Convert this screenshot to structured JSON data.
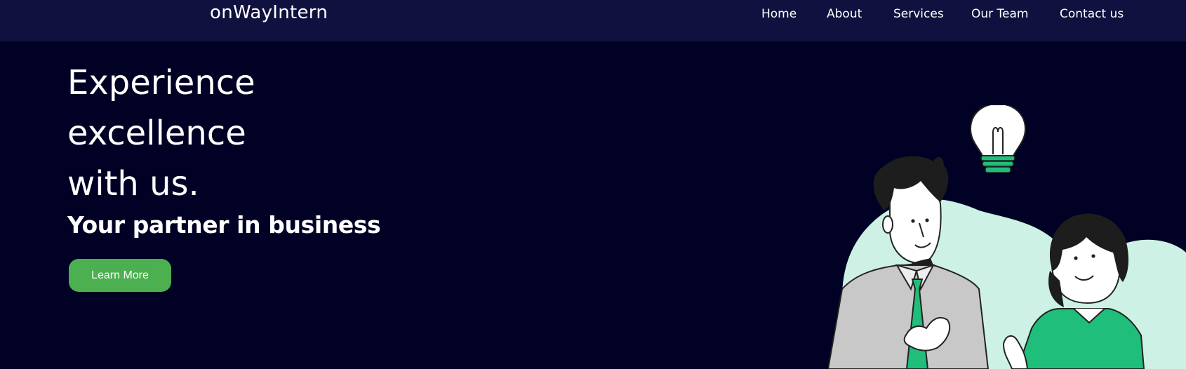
{
  "navbar": {
    "brand": "onWayIntern",
    "links": [
      "Home",
      "About",
      "Services",
      "Our Team",
      "Contact us"
    ]
  },
  "hero": {
    "title_lines": [
      "Experience",
      "excellence",
      "with us."
    ],
    "subtitle": "Your partner in business",
    "cta_label": "Learn More"
  },
  "colors": {
    "page_background": "#000124",
    "navbar_background": "#11113f",
    "cta_background": "#4caf50",
    "illustration_blob": "#cdf1e4",
    "illustration_accent": "#1fbe7a"
  },
  "illustration": {
    "icon": "business-people-lightbulb-illustration"
  }
}
